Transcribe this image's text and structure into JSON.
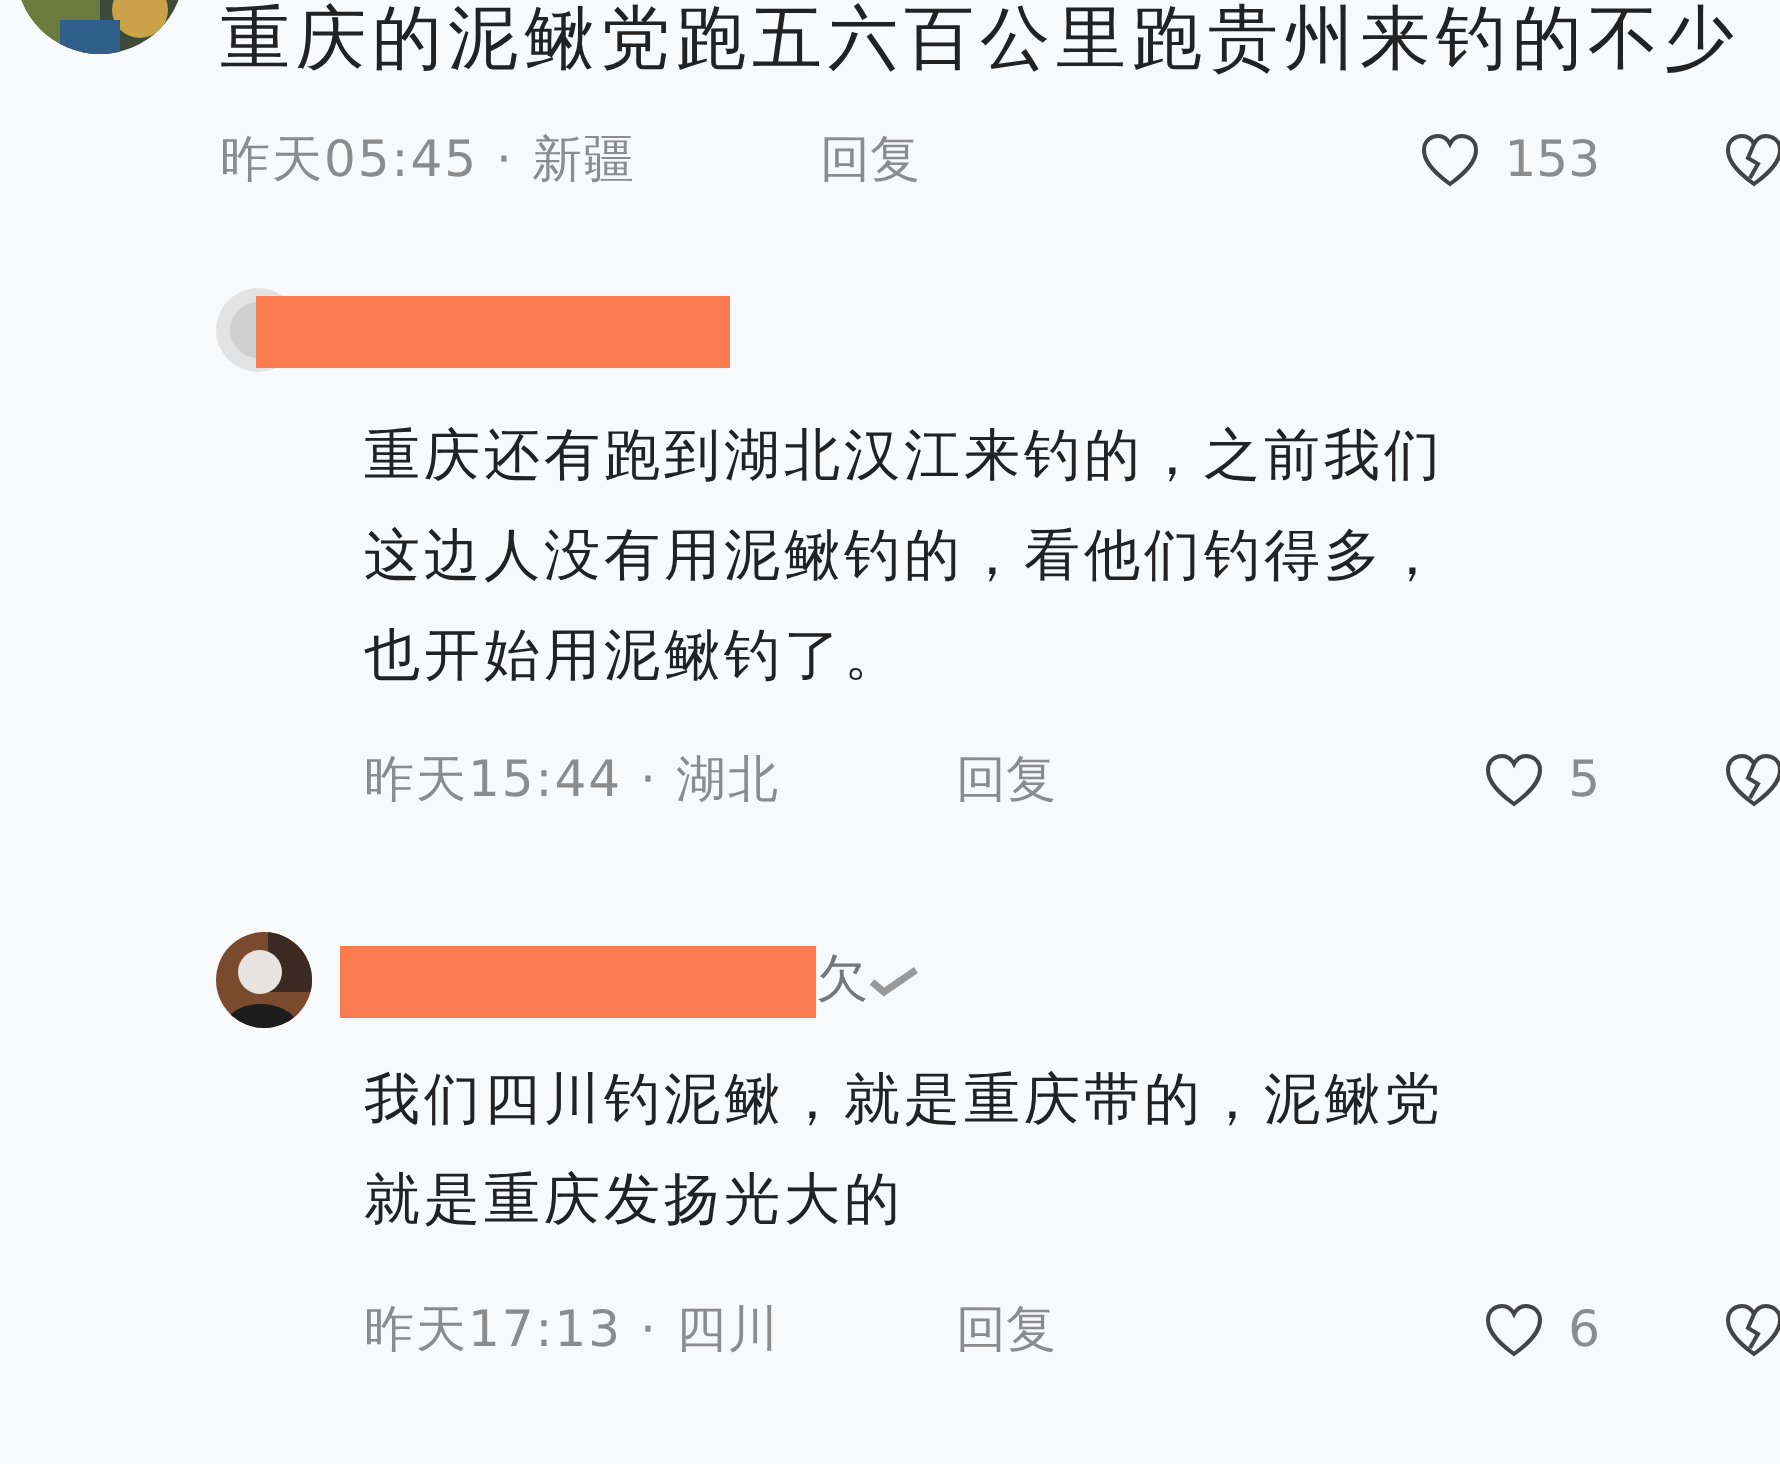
{
  "comment": {
    "text": "重庆的泥鳅党跑五六百公里跑贵州来钓的不少",
    "meta": "昨天05:45 · 新疆",
    "reply_label": "回复",
    "likes": "153"
  },
  "replies": [
    {
      "lines": [
        "重庆还有跑到湖北汉江来钓的，之前我们",
        "这边人没有用泥鳅钓的，看他们钓得多，",
        "也开始用泥鳅钓了。"
      ],
      "meta": "昨天15:44 · 湖北",
      "reply_label": "回复",
      "likes": "5"
    },
    {
      "username_tail": "欠",
      "verified": true,
      "lines": [
        "我们四川钓泥鳅，就是重庆带的，泥鳅党",
        "就是重庆发扬光大的"
      ],
      "meta": "昨天17:13 · 四川",
      "reply_label": "回复",
      "likes": "6"
    }
  ]
}
